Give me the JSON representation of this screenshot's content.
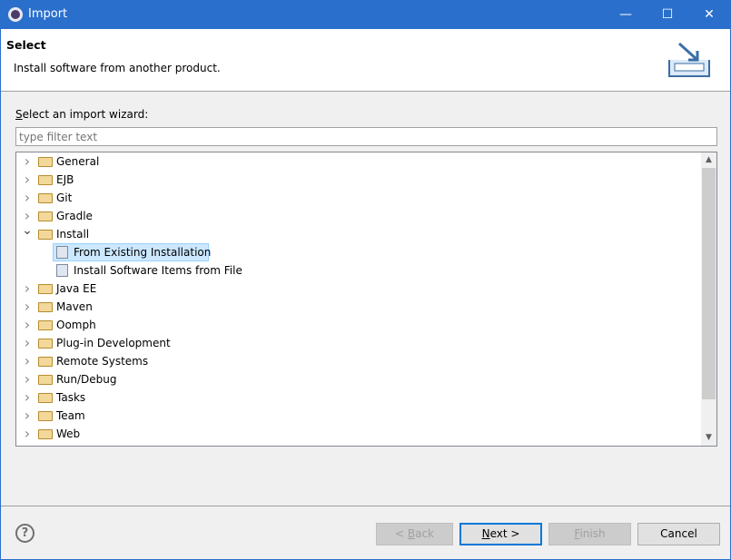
{
  "window": {
    "title": "Import",
    "minimize": "—",
    "maximize": "☐",
    "close": "✕"
  },
  "header": {
    "title": "Select",
    "description": "Install software from another product."
  },
  "wizard_label": {
    "mnemonic": "S",
    "rest": "elect an import wizard:"
  },
  "filter": {
    "value": "",
    "placeholder": "type filter text"
  },
  "tree": [
    {
      "label": "General",
      "expanded": false
    },
    {
      "label": "EJB",
      "expanded": false
    },
    {
      "label": "Git",
      "expanded": false
    },
    {
      "label": "Gradle",
      "expanded": false
    },
    {
      "label": "Install",
      "expanded": true,
      "children": [
        {
          "label": "From Existing Installation",
          "selected": true
        },
        {
          "label": "Install Software Items from File",
          "selected": false
        }
      ]
    },
    {
      "label": "Java EE",
      "expanded": false
    },
    {
      "label": "Maven",
      "expanded": false
    },
    {
      "label": "Oomph",
      "expanded": false
    },
    {
      "label": "Plug-in Development",
      "expanded": false
    },
    {
      "label": "Remote Systems",
      "expanded": false
    },
    {
      "label": "Run/Debug",
      "expanded": false
    },
    {
      "label": "Tasks",
      "expanded": false
    },
    {
      "label": "Team",
      "expanded": false
    },
    {
      "label": "Web",
      "expanded": false
    }
  ],
  "buttons": {
    "back": {
      "pre": "< ",
      "mn": "B",
      "rest": "ack",
      "enabled": false
    },
    "next": {
      "pre": "",
      "mn": "N",
      "rest": "ext >",
      "enabled": true
    },
    "finish": {
      "pre": "",
      "mn": "F",
      "rest": "inish",
      "enabled": false
    },
    "cancel": {
      "label": "Cancel",
      "enabled": true
    }
  },
  "help": "?",
  "colors": {
    "titlebar": "#2b6fcc",
    "selection": "#cce8ff",
    "default_button_border": "#0078d7"
  }
}
